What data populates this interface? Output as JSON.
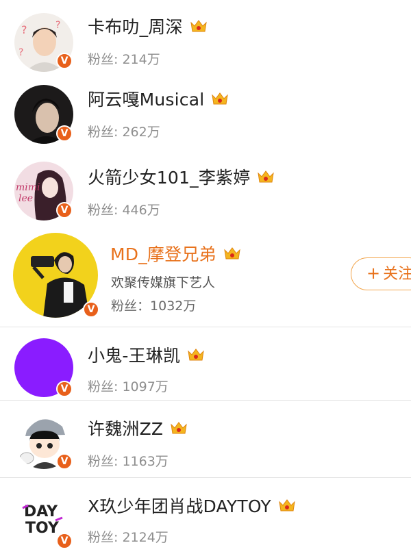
{
  "fans_prefix": "粉丝: ",
  "users": [
    {
      "name": "卡布叻_周深",
      "fans": "214万"
    },
    {
      "name": "阿云嘎Musical",
      "fans": "262万"
    },
    {
      "name": "火箭少女101_李紫婷",
      "fans": "446万"
    },
    {
      "name": "MD_摩登兄弟",
      "description": "欢聚传媒旗下艺人",
      "fans_prefix": "粉丝：",
      "fans": "1032万",
      "follow_button": "关注"
    },
    {
      "name": "小鬼-王琳凯",
      "fans": "1097万"
    },
    {
      "name": "许魏洲ZZ",
      "fans": "1163万"
    },
    {
      "name": "X玖少年团肖战DAYTOY",
      "fans": "2124万"
    }
  ],
  "avatar_texts": {
    "user3_line1": "mimi",
    "user3_line2": "lee",
    "user7_line1": "DAY",
    "user7_line2": "TOY"
  },
  "badge_letter": "V",
  "icons": {
    "crown": "crown-icon",
    "verified": "verified-badge-icon",
    "plus": "plus-icon"
  },
  "colors": {
    "accent_orange": "#e8721c",
    "badge_orange": "#e8601b",
    "crown_gold": "#f4b51f",
    "fans_gray": "#8e8e8e",
    "purple_avatar": "#8a1cff"
  }
}
